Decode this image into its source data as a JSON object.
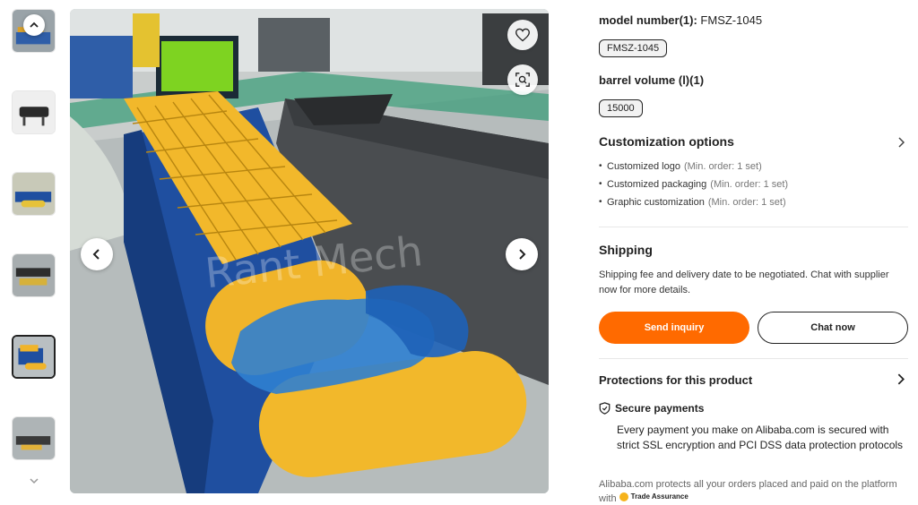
{
  "gallery": {
    "thumbnails": [
      {
        "label": "thumb-1",
        "colors": [
          "#2f5ea8",
          "#8a8f93",
          "#d9a02a"
        ]
      },
      {
        "label": "thumb-2",
        "colors": [
          "#ececec",
          "#2a2a2a",
          "#6b6b6b"
        ]
      },
      {
        "label": "thumb-3",
        "colors": [
          "#c8b36a",
          "#1f4fa0",
          "#e6c23a"
        ]
      },
      {
        "label": "thumb-4",
        "colors": [
          "#9aa0a2",
          "#2d2d2d",
          "#d6b13a"
        ]
      },
      {
        "label": "thumb-5",
        "colors": [
          "#b9bfc2",
          "#1f4fa0",
          "#f0b42a"
        ]
      },
      {
        "label": "thumb-6",
        "colors": [
          "#aeb4b6",
          "#3a3a3a",
          "#e2b23a"
        ]
      }
    ],
    "active_index": 4,
    "watermark": "Rant Mech"
  },
  "specs": {
    "model_label": "model number(1):",
    "model_value": "FMSZ-1045",
    "model_chip": "FMSZ-1045",
    "barrel_label": "barrel volume (l)(1)",
    "barrel_chip": "15000"
  },
  "customization": {
    "title": "Customization options",
    "items": [
      {
        "label": "Customized logo",
        "note": "(Min. order: 1 set)"
      },
      {
        "label": "Customized packaging",
        "note": "(Min. order: 1 set)"
      },
      {
        "label": "Graphic customization",
        "note": "(Min. order: 1 set)"
      }
    ]
  },
  "shipping": {
    "title": "Shipping",
    "text": "Shipping fee and delivery date to be negotiated. Chat with supplier now for more details."
  },
  "actions": {
    "send_inquiry": "Send inquiry",
    "chat_now": "Chat now"
  },
  "protections": {
    "title": "Protections for this product",
    "secure_title": "Secure payments",
    "secure_text": "Every payment you make on Alibaba.com is secured with strict SSL encryption and PCI DSS data protection protocols",
    "footer_text": "Alibaba.com protects all your orders placed and paid on the platform with",
    "badge": "Trade Assurance"
  },
  "colors": {
    "accent": "#ff6a00",
    "machine_blue": "#1f4fa0",
    "machine_yellow": "#f2b82b",
    "machine_gray": "#4a4d50"
  },
  "icons": {
    "favorite": "heart-icon",
    "image_search": "image-search-icon",
    "prev": "chevron-left-icon",
    "next": "chevron-right-icon",
    "up": "chevron-up-icon",
    "down": "chevron-down-icon",
    "shield": "shield-check-icon"
  }
}
